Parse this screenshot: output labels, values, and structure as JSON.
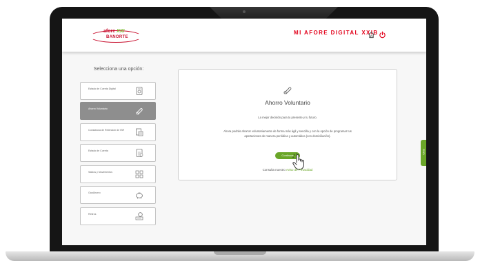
{
  "header": {
    "logo": {
      "top": "afore",
      "xxi": "XXI",
      "bottom": "BANORTE"
    },
    "title": "MI AFORE DIGITAL XXIB",
    "icons": {
      "home": "home-icon",
      "power": "power-icon"
    },
    "accent_color": "#e2001a"
  },
  "sidebar": {
    "title": "Selecciona una opción:",
    "items": [
      {
        "label": "Estado de Cuenta Digital",
        "icon": "digital-statement-icon",
        "active": false
      },
      {
        "label": "Ahorro Voluntario",
        "icon": "voluntary-savings-icon",
        "active": true
      },
      {
        "label": "Constancia de Retención de ISR",
        "icon": "tax-certificate-icon",
        "active": false
      },
      {
        "label": "Estado de Cuenta",
        "icon": "account-statement-icon",
        "active": false
      },
      {
        "label": "Saldos y Movimientos",
        "icon": "balances-icon",
        "active": false
      },
      {
        "label": "GanAhorro",
        "icon": "piggy-bank-icon",
        "active": false
      },
      {
        "label": "Retiros",
        "icon": "withdrawals-icon",
        "active": false
      }
    ]
  },
  "panel": {
    "icon": "voluntary-savings-icon",
    "title": "Ahorro Voluntario",
    "subtitle": "La mejor decisión para tu presente y tu futuro.",
    "description": "Ahora podrás ahorrar voluntariamente de forma más ágil y sencilla y con la opción de programar tus aportaciones de manera periódica y automática (con domiciliación).",
    "button_label": "Continuar",
    "privacy_prefix": "Consulta nuestro",
    "privacy_link": "Aviso de Privacidad"
  },
  "chat": {
    "label": "Chat"
  },
  "colors": {
    "brand_red": "#e2001a",
    "brand_green": "#6aa628",
    "active_gray": "#8e8e8e"
  }
}
